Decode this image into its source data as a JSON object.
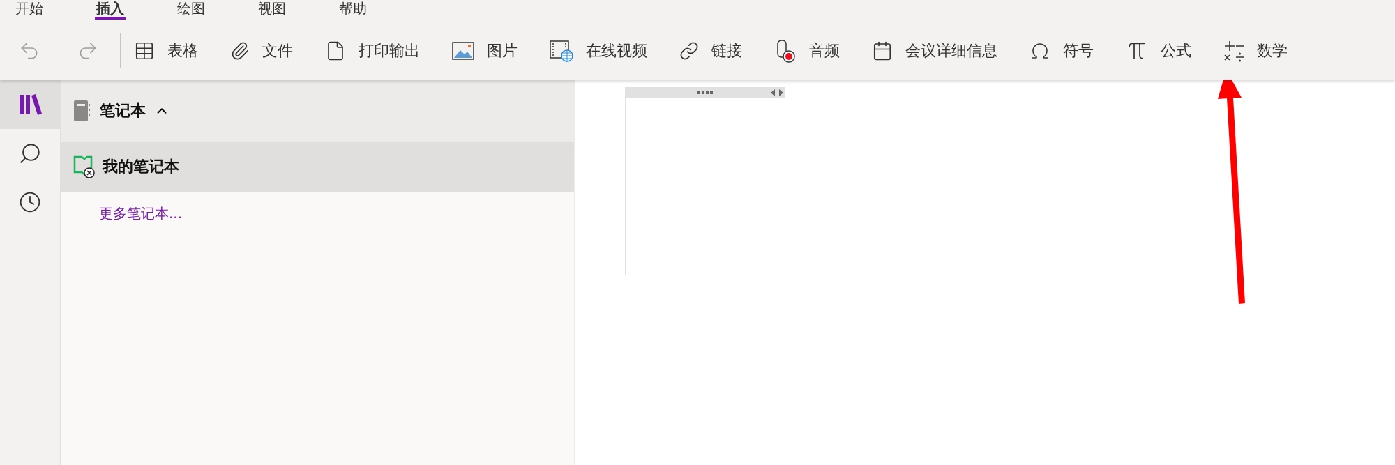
{
  "ribbon": {
    "tabs": [
      {
        "label": "开始",
        "selected": false
      },
      {
        "label": "插入",
        "selected": true
      },
      {
        "label": "绘图",
        "selected": false
      },
      {
        "label": "视图",
        "selected": false
      },
      {
        "label": "帮助",
        "selected": false
      }
    ],
    "history": {
      "undo": {
        "disabled": true
      },
      "redo": {
        "disabled": true
      }
    },
    "tools": [
      {
        "label": "表格"
      },
      {
        "label": "文件"
      },
      {
        "label": "打印输出"
      },
      {
        "label": "图片"
      },
      {
        "label": "在线视频"
      },
      {
        "label": "链接"
      },
      {
        "label": "音频"
      },
      {
        "label": "会议详细信息"
      },
      {
        "label": "符号"
      },
      {
        "label": "公式"
      },
      {
        "label": "数学"
      }
    ]
  },
  "rail": [
    {
      "selected": true
    },
    {
      "selected": false
    },
    {
      "selected": false
    }
  ],
  "notebooks_panel": {
    "title": "笔记本",
    "expanded": true,
    "notebooks": [
      {
        "name": "我的笔记本",
        "selected": true
      }
    ],
    "more_link": "更多笔记本..."
  },
  "canvas": {
    "note_container": {
      "kind": "empty"
    }
  }
}
